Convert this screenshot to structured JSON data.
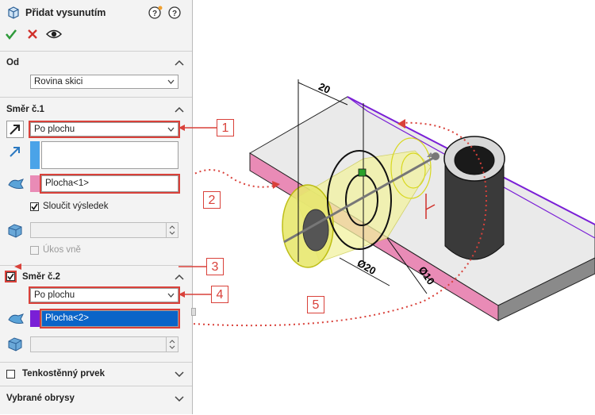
{
  "panel": {
    "title": "Přidat vysunutím",
    "sections": {
      "od": {
        "label": "Od",
        "select": "Rovina skici"
      },
      "smer1": {
        "label": "Směr č.1",
        "type_select": "Po plochu",
        "face_value": "Plocha<1>",
        "merge_label": "Sloučit výsledek",
        "draft_label": "Úkos vně"
      },
      "smer2": {
        "label": "Směr č.2",
        "type_select": "Po plochu",
        "face_value": "Plocha<2>"
      },
      "thin": {
        "label": "Tenkostěnný prvek"
      },
      "contours": {
        "label": "Vybrané obrysy"
      }
    },
    "colors": {
      "accent_red": "#d9413a",
      "selection_blue": "#0a64c8",
      "face_pink": "#e98bb6"
    }
  },
  "callouts": [
    "1",
    "2",
    "3",
    "4",
    "5"
  ],
  "dimensions": {
    "d1": "20",
    "d2": "Ø20",
    "d3": "Ø10"
  }
}
